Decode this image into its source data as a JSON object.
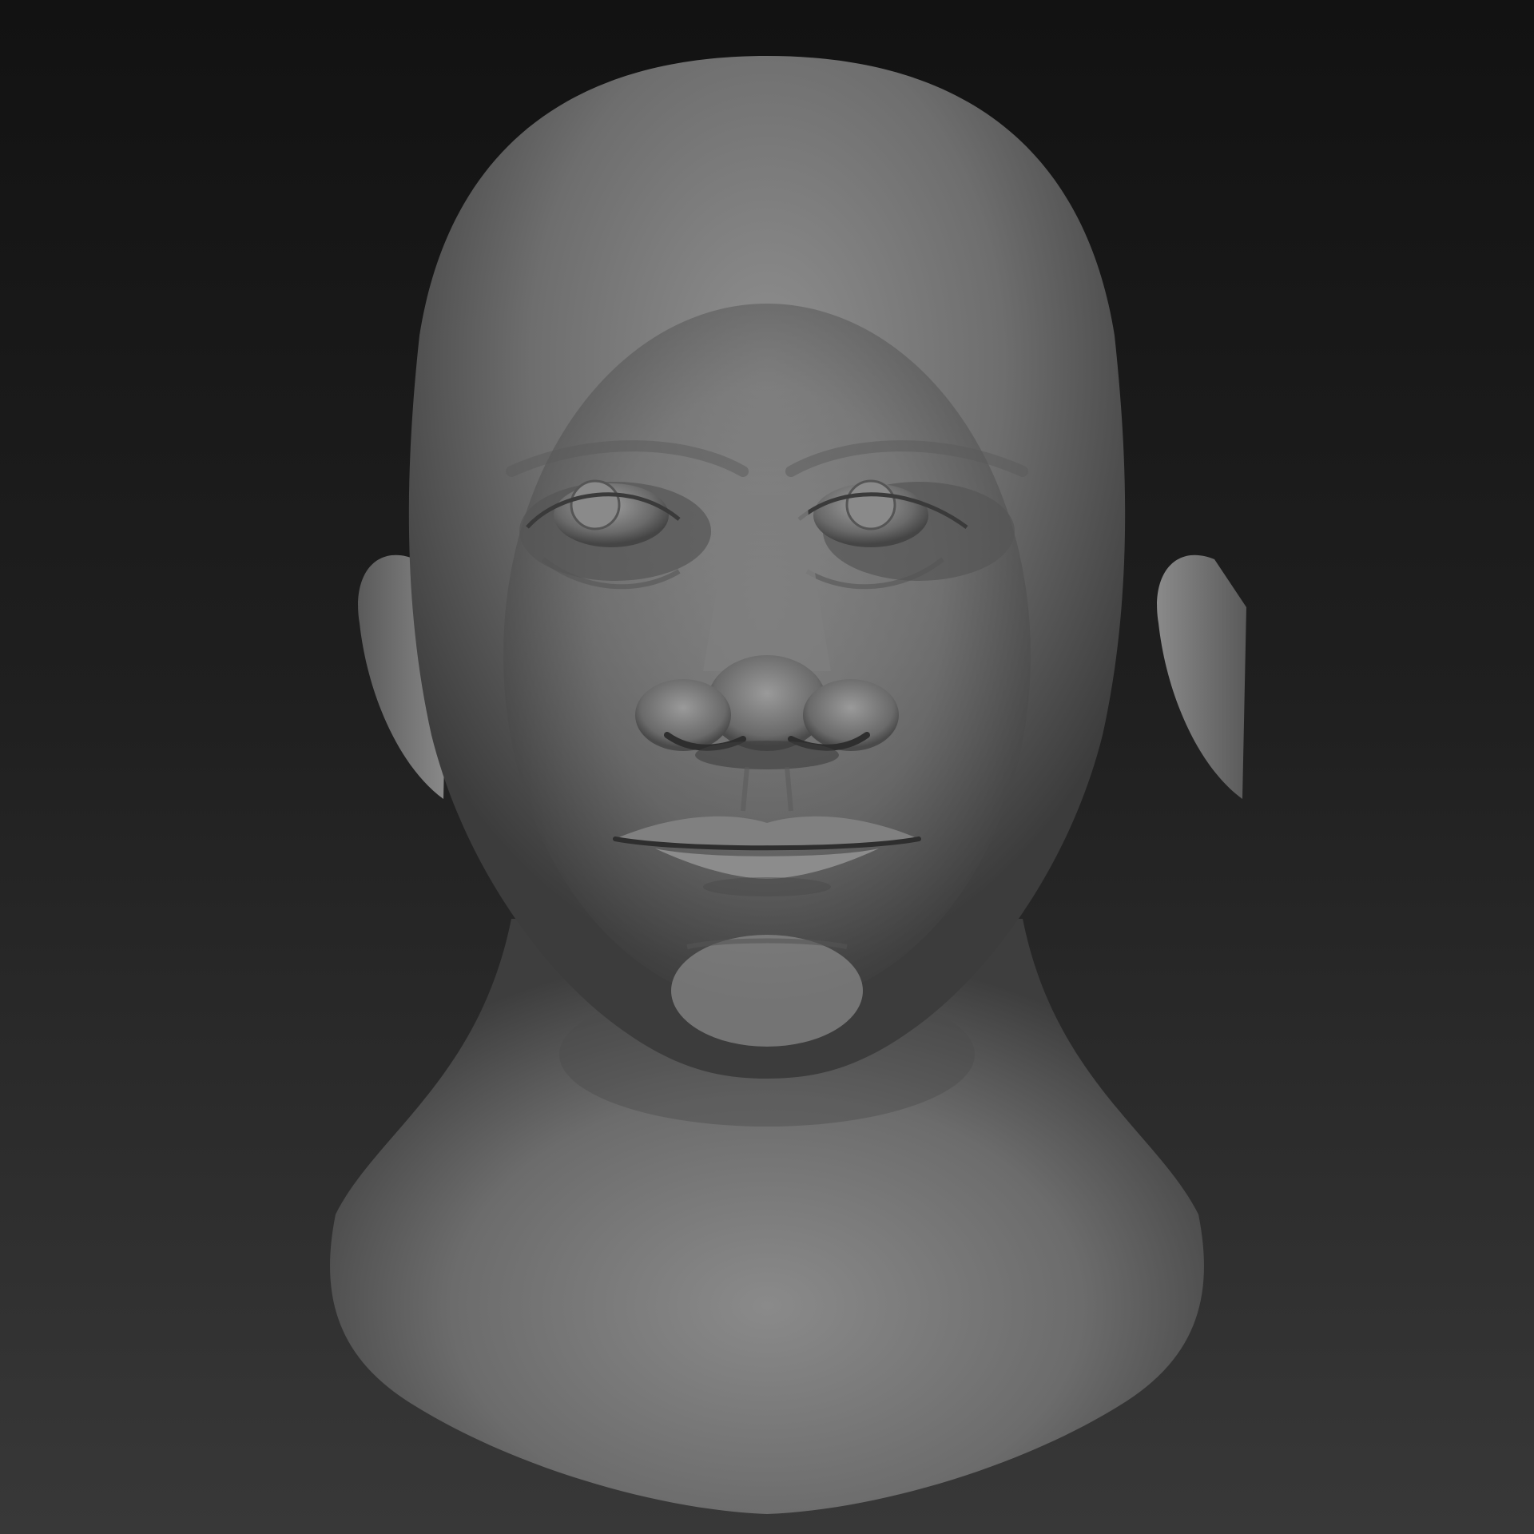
{
  "scene": {
    "subject_icon": "sculpted-head-bust-icon",
    "colors": {
      "background_top": "#121212",
      "background_bottom": "#383838",
      "clay_light": "#9a9a9a",
      "clay_mid": "#7a7a7a",
      "clay_dark": "#3a3a3a"
    }
  }
}
